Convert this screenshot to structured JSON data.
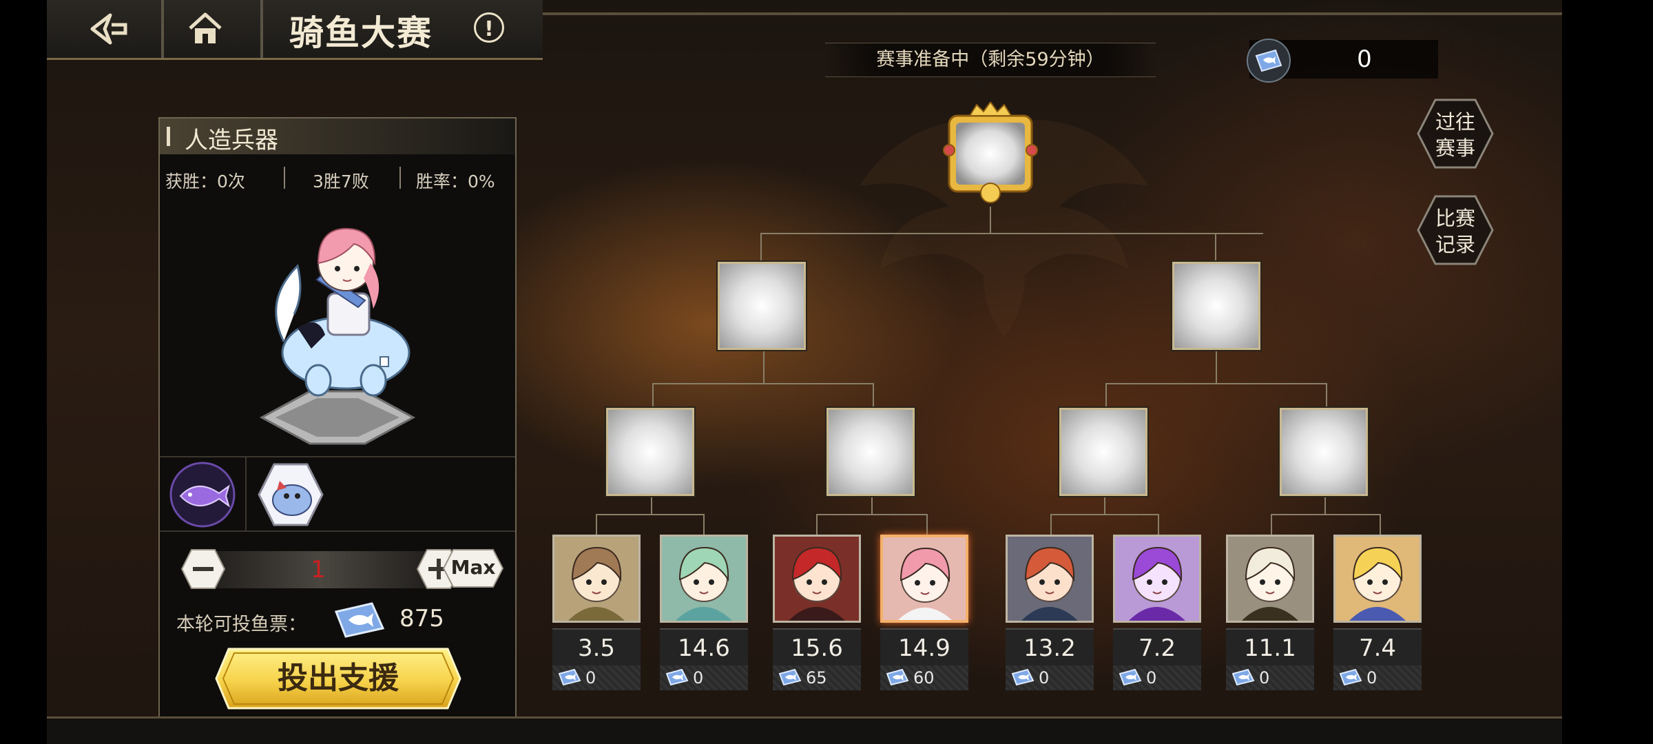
{
  "header": {
    "title": "骑鱼大赛",
    "back_icon": "back-arrow-icon",
    "home_icon": "home-icon",
    "info_icon": "!"
  },
  "status": {
    "text": "赛事准备中（剩余59分钟）"
  },
  "tickets": {
    "count": "0",
    "icon": "fish-ticket-icon"
  },
  "side_buttons": [
    {
      "label": "过往\n赛事"
    },
    {
      "label": "比赛\n记录"
    }
  ],
  "panel": {
    "name": "人造兵器",
    "wins": "获胜：0次",
    "record": "3胜7败",
    "win_rate": "胜率：0%",
    "quantity": "1",
    "max_label": "Max",
    "vote_label": "本轮可投鱼票：",
    "vote_count": "875",
    "support_button": "投出支援"
  },
  "colors": {
    "accent_gold": "#f6d24a",
    "frame": "#c9b98f",
    "selected_border": "#f4b06a",
    "qty_red": "#c92020"
  },
  "fighters": [
    {
      "odds": "3.5",
      "votes": "0",
      "hair": "#a07a55",
      "skin": "#fbe8d0",
      "cloth": "#7a6a3a",
      "bg": "#b7a27a"
    },
    {
      "odds": "14.6",
      "votes": "0",
      "hair": "#9fd6b5",
      "skin": "#fdf0e0",
      "cloth": "#5aa3a0",
      "bg": "#8fb9a8"
    },
    {
      "odds": "15.6",
      "votes": "65",
      "hair": "#c42828",
      "skin": "#fde3d0",
      "cloth": "#3a1a1a",
      "bg": "#7a3028"
    },
    {
      "odds": "14.9",
      "votes": "60",
      "hair": "#f09aac",
      "skin": "#fff2ea",
      "cloth": "#f4f4f4",
      "bg": "#e6b9b0",
      "selected": true
    },
    {
      "odds": "13.2",
      "votes": "0",
      "hair": "#d45a3a",
      "skin": "#fde0cc",
      "cloth": "#2c3a55",
      "bg": "#6a6a78"
    },
    {
      "odds": "7.2",
      "votes": "0",
      "hair": "#9a4ad6",
      "skin": "#f5e2ff",
      "cloth": "#6a2aa8",
      "bg": "#b99ad6"
    },
    {
      "odds": "11.1",
      "votes": "0",
      "hair": "#f2ecdc",
      "skin": "#fff4e8",
      "cloth": "#3a3020",
      "bg": "#9a9080"
    },
    {
      "odds": "7.4",
      "votes": "0",
      "hair": "#f5d256",
      "skin": "#fff0dc",
      "cloth": "#4a5ab0",
      "bg": "#e0b878"
    }
  ]
}
